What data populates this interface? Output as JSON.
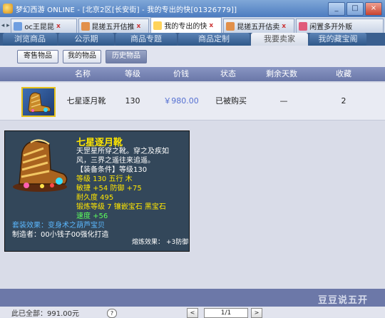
{
  "window": {
    "title": "梦幻西游 ONLINE - [北京2区[长安街] - 我的专出的快[01326779]]",
    "min_label": "_",
    "max_label": "□",
    "close_label": "×"
  },
  "browser_tabs": [
    {
      "label": "oc王昆昆",
      "icon_color": "#6f9ee0",
      "active": false
    },
    {
      "label": "昆搓五开估推",
      "icon_color": "#e2904a",
      "active": false
    },
    {
      "label": "我的专出的快",
      "icon_color": "#ffd35a",
      "active": true
    },
    {
      "label": "昆搓五开估卖",
      "icon_color": "#e2904a",
      "active": false
    },
    {
      "label": "闲置多开外贩",
      "icon_color": "#e05a7a",
      "active": false
    }
  ],
  "nav_tabs": [
    {
      "label": "浏览商品",
      "active": false
    },
    {
      "label": "公示期",
      "active": false
    },
    {
      "label": "商品专题",
      "active": false
    },
    {
      "label": "商品定制",
      "active": false
    },
    {
      "label": "我要卖家",
      "active": true
    },
    {
      "label": "我的藏宝阁",
      "active": false
    }
  ],
  "sub_tabs": [
    {
      "label": "寄售物品",
      "active": false
    },
    {
      "label": "我的物品",
      "active": false
    },
    {
      "label": "历史物品",
      "active": true
    }
  ],
  "table": {
    "headers": [
      "名称",
      "等级",
      "价钱",
      "状态",
      "剩余天数",
      "收藏"
    ],
    "rows": [
      {
        "name": "七星逐月靴",
        "level": "130",
        "price": "￥980.00",
        "status": "已被购买",
        "days": "—",
        "favs": "2"
      }
    ]
  },
  "tooltip": {
    "name": "七星逐月靴",
    "lines": [
      "天罡星所穿之靴。穿之及疾如",
      "风，三界之遥往来追遥。",
      "【装备条件】等级130",
      "等级 130  五行 木",
      "敏捷 +54 防御 +75",
      "耐久度 495",
      "锻炼等级 7  镶嵌宝石 黑宝石",
      "速度 +56",
      "套装效果：变身术之葫芦宝贝",
      "制造者：00小钱子00强化打造",
      "熔炼效果：",
      "+3防御"
    ]
  },
  "footer": {
    "total_text": "此已全部：991.00元",
    "help_label": "?",
    "page_text": "1/1",
    "prev_label": "<",
    "next_label": ">",
    "watermark": "豆豆说五开"
  },
  "colors": {
    "accent": "#6c78a8",
    "tooltip_title": "#ffe600",
    "tooltip_bg": "#33475a",
    "price": "#5570d2"
  }
}
